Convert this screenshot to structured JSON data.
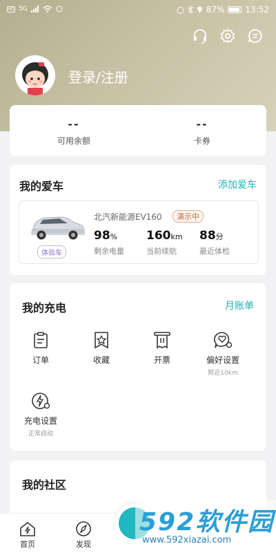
{
  "status_bar": {
    "left_icons": [
      "HD",
      "5G"
    ],
    "battery": "87%",
    "time": "13:52"
  },
  "header": {
    "icons": [
      "headset-icon",
      "gear-icon",
      "message-icon"
    ],
    "login_label": "登录/注册"
  },
  "balance": {
    "available": {
      "value": "--",
      "label": "可用余额"
    },
    "coupon": {
      "value": "--",
      "label": "卡券"
    }
  },
  "my_car": {
    "title": "我的爱车",
    "add_link": "添加爱车",
    "trial_badge": "体验车",
    "car_name": "北汽新能源EV160",
    "demo_badge": "演示中",
    "stats": [
      {
        "num": "98",
        "unit": "%",
        "label": "剩余电量"
      },
      {
        "num": "160",
        "unit": "km",
        "label": "当前续航"
      },
      {
        "num": "88",
        "unit": "分",
        "label": "最近体检"
      }
    ]
  },
  "my_charging": {
    "title": "我的充电",
    "monthly_link": "月账单",
    "items": [
      {
        "label": "订单",
        "sub": ""
      },
      {
        "label": "收藏",
        "sub": ""
      },
      {
        "label": "开票",
        "sub": ""
      },
      {
        "label": "偏好设置",
        "sub": "附近10km"
      },
      {
        "label": "充电设置",
        "sub": "正常启动"
      }
    ]
  },
  "community": {
    "title": "我的社区"
  },
  "bottom_nav": {
    "home": "首页",
    "discover": "发现"
  },
  "watermark": {
    "big": "592软件园",
    "small": "www.592xiazai.com"
  },
  "colors": {
    "accent": "#1fb3b9",
    "hero": "#b4ad8f"
  }
}
